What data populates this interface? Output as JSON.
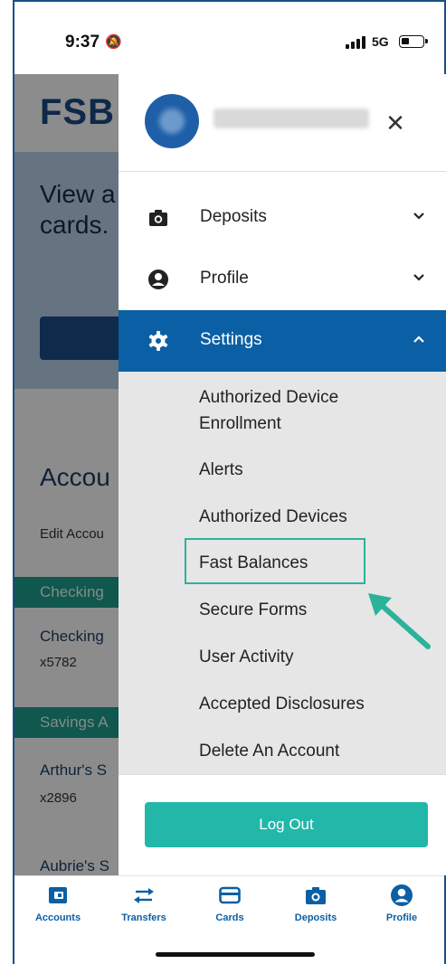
{
  "status_bar": {
    "time": "9:37",
    "network": "5G"
  },
  "background": {
    "logo": "FSB",
    "hero_text_line1": "View a",
    "hero_text_line2": "cards.",
    "accounts_title": "Accou",
    "edit_link": "Edit Accou",
    "checking_band": "Checking",
    "checking_name": "Checking",
    "checking_number": "x5782",
    "savings_band": "Savings A",
    "savings_name": "Arthur's S",
    "savings_number": "x2896",
    "next_account": "Aubrie's S"
  },
  "drawer": {
    "menu": [
      {
        "label": "Deposits",
        "icon": "camera-icon"
      },
      {
        "label": "Profile",
        "icon": "user-circle-icon"
      },
      {
        "label": "Settings",
        "icon": "gear-icon"
      }
    ],
    "settings_items": [
      "Authorized Device\nEnrollment",
      "Alerts",
      "Authorized Devices",
      "Fast Balances",
      "Secure Forms",
      "User Activity",
      "Accepted Disclosures",
      "Delete An Account"
    ],
    "logout_label": "Log Out"
  },
  "tabbar": [
    {
      "label": "Accounts",
      "icon": "wallet-icon"
    },
    {
      "label": "Transfers",
      "icon": "transfer-arrows-icon"
    },
    {
      "label": "Cards",
      "icon": "card-icon"
    },
    {
      "label": "Deposits",
      "icon": "camera-icon"
    },
    {
      "label": "Profile",
      "icon": "user-circle-icon"
    }
  ],
  "colors": {
    "primary_blue": "#0b5fa5",
    "teal": "#22b7a8",
    "highlight": "#2bb39a"
  }
}
